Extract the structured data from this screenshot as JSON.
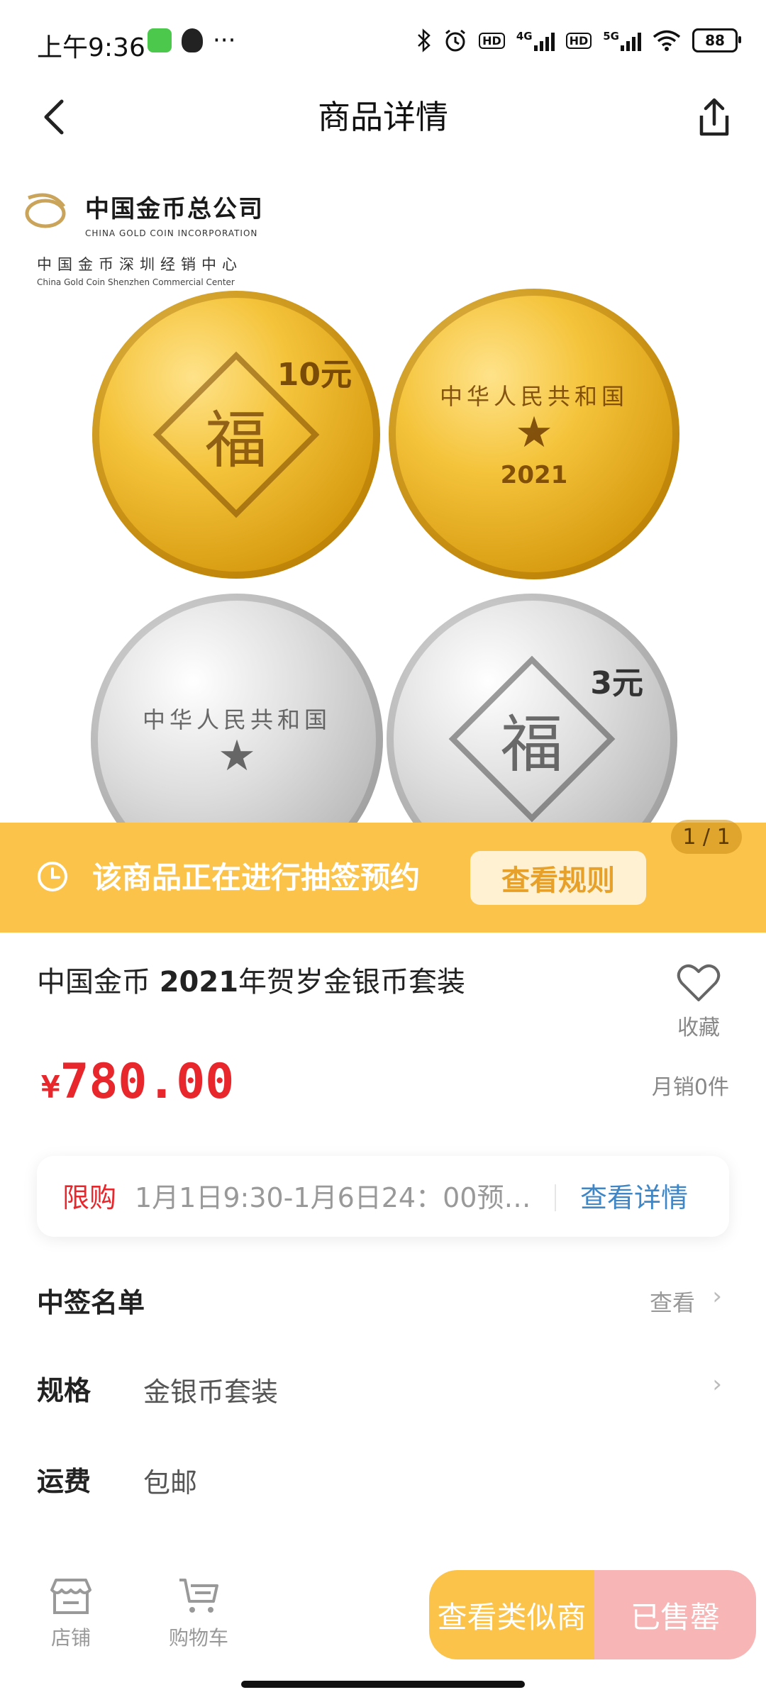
{
  "status_bar": {
    "time": "上午9:36",
    "dots": "···",
    "network_4g": "4G",
    "network_5g": "5G",
    "hd1": "HD",
    "hd2": "HD",
    "battery": "88"
  },
  "nav": {
    "title": "商品详情"
  },
  "gallery": {
    "logo_cn": "中国金币总公司",
    "logo_en": "CHINA GOLD COIN INCORPORATION",
    "logo_sub": "中国金币深圳经销中心",
    "logo_sub_en": "China Gold Coin Shenzhen Commercial Center",
    "coin_gold_denom": "10元",
    "coin_silver_denom": "3元",
    "coin_fu": "福",
    "emblem_ring": "中华人民共和国",
    "emblem_year": "2021",
    "counter": "1 / 1"
  },
  "lottery": {
    "text": "该商品正在进行抽签预约",
    "rules_button": "查看规则"
  },
  "product": {
    "title_prefix": "中国金币 ",
    "title_bold": "2021",
    "title_suffix": "年贺岁金银币套装",
    "favorite_label": "收藏",
    "currency": "¥",
    "price": "780.00",
    "monthly_sales": "月销0件"
  },
  "limit": {
    "tag": "限购",
    "desc": "1月1日9:30-1月6日24：00预约...",
    "detail_link": "查看详情"
  },
  "rows": {
    "winners_label": "中签名单",
    "winners_action": "查看",
    "spec_label": "规格",
    "spec_value": "金银币套装",
    "shipping_label": "运费",
    "shipping_value": "包邮"
  },
  "bottom": {
    "store_label": "店铺",
    "cart_label": "购物车",
    "similar_button": "查看类似商",
    "soldout_button": "已售罄"
  },
  "colors": {
    "accent_yellow": "#fcc34a",
    "price_red": "#e8272d",
    "link_blue": "#3f86c7",
    "soldout_pink": "#f7b5b5"
  }
}
